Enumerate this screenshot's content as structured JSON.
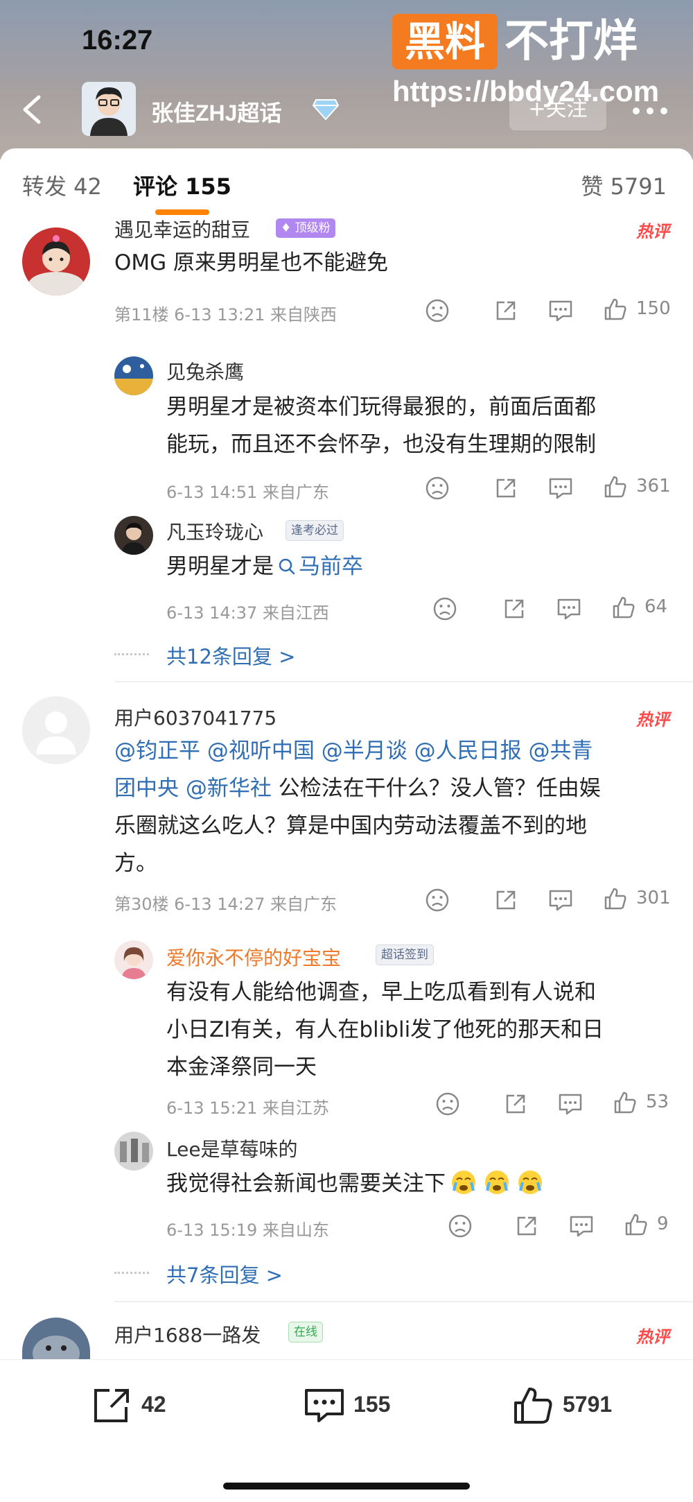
{
  "status_bar": {
    "time": "16:27"
  },
  "header": {
    "topic": "张佳ZHJ超话",
    "follow_label": "+关注",
    "more_label": "•••"
  },
  "watermark": {
    "badge": "黑料",
    "title": "不打烊",
    "url": "https://bbdy24.com"
  },
  "tabs": {
    "repost": "转发 42",
    "comment": "评论 155",
    "like": "赞 5791"
  },
  "colors": {
    "accent": "#ff8200",
    "link": "#2f6eb5",
    "hot": "#ff4a4a",
    "orange_name": "#f07a2b"
  },
  "comments": [
    {
      "user": "遇见幸运的甜豆",
      "badge": "♦ 顶级粉",
      "hot": "热评",
      "text": "OMG 原来男明星也不能避免",
      "meta": "第11楼  6-13 13:21  来自陕西",
      "likes": "150",
      "replies": [
        {
          "user": "见兔杀鹰",
          "text_line1": "男明星才是被资本们玩得最狠的，前面后面都",
          "text_line2": "能玩，而且还不会怀孕，也没有生理期的限制",
          "meta": "6-13 14:51  来自广东",
          "likes": "361"
        },
        {
          "user": "凡玉玲珑心",
          "badge": "逢考必过",
          "text": "男明星才是",
          "search_link": "马前卒",
          "meta": "6-13 14:37  来自江西",
          "likes": "64"
        }
      ],
      "more_replies": "共12条回复 >"
    },
    {
      "user": "用户6037041775",
      "hot": "热评",
      "text_line1": [
        "@钧正平",
        "@视听中国",
        "@半月谈",
        "@人民日报",
        "@共青"
      ],
      "text_line2_mention": "团中央 @新华社",
      "text_line2_rest": " 公检法在干什么？没人管？任由娱",
      "text_line3": "乐圈就这么吃人？算是中国内劳动法覆盖不到的地",
      "text_line4": "方。",
      "meta": "第30楼  6-13 14:27  来自广东",
      "likes": "301",
      "replies": [
        {
          "user": "爱你永不停的好宝宝",
          "badge": "超话签到",
          "text_line1": "有没有人能给他调查，早上吃瓜看到有人说和",
          "text_line2": "小日ZI有关，有人在blibli发了他死的那天和日",
          "text_line3": "本金泽祭同一天",
          "meta": "6-13 15:21  来自江苏",
          "likes": "53"
        },
        {
          "user": "Lee是草莓味的",
          "text": "我觉得社会新闻也需要关注下",
          "meta": "6-13 15:19  来自山东",
          "likes": "9"
        }
      ],
      "more_replies": "共7条回复 >"
    },
    {
      "user": "用户1688一路发",
      "badge": "在线",
      "hot": "热评"
    }
  ],
  "bottom_bar": {
    "repost_count": "42",
    "comment_count": "155",
    "like_count": "5791"
  }
}
